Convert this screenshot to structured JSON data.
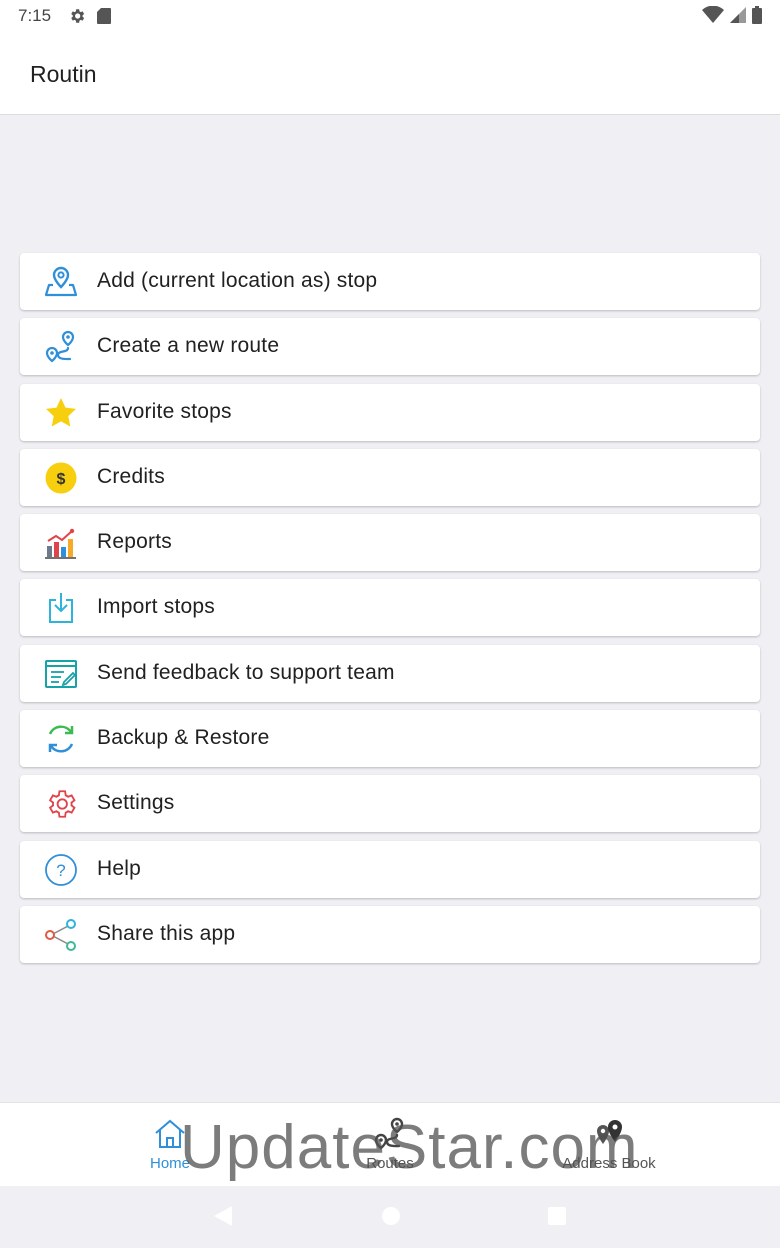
{
  "status_bar": {
    "time": "7:15"
  },
  "app_bar": {
    "title": "Routin"
  },
  "menu": {
    "items": [
      {
        "id": "add-stop",
        "label": "Add (current location as) stop",
        "icon": "location-map-icon"
      },
      {
        "id": "create-route",
        "label": "Create a new route",
        "icon": "route-icon"
      },
      {
        "id": "favorite-stops",
        "label": "Favorite stops",
        "icon": "star-icon"
      },
      {
        "id": "credits",
        "label": "Credits",
        "icon": "dollar-coin-icon"
      },
      {
        "id": "reports",
        "label": "Reports",
        "icon": "bar-chart-icon"
      },
      {
        "id": "import-stops",
        "label": "Import stops",
        "icon": "import-icon"
      },
      {
        "id": "send-feedback",
        "label": "Send feedback to support team",
        "icon": "feedback-form-icon"
      },
      {
        "id": "backup-restore",
        "label": "Backup & Restore",
        "icon": "sync-icon"
      },
      {
        "id": "settings",
        "label": "Settings",
        "icon": "gear-icon"
      },
      {
        "id": "help",
        "label": "Help",
        "icon": "help-icon"
      },
      {
        "id": "share-app",
        "label": "Share this app",
        "icon": "share-icon"
      }
    ]
  },
  "bottom_nav": {
    "home": {
      "label": "Home",
      "icon": "home-icon",
      "active": true
    },
    "routes": {
      "label": "Routes",
      "icon": "route-icon"
    },
    "address_book": {
      "label": "Address Book",
      "icon": "map-pins-icon"
    }
  },
  "watermark": {
    "text": "UpdateStar.com"
  },
  "colors": {
    "background": "#efeff4",
    "accent_blue": "#2f8fd8",
    "star_yellow": "#f7cf0f",
    "settings_red": "#e0444b",
    "sync_green": "#3cba54"
  }
}
